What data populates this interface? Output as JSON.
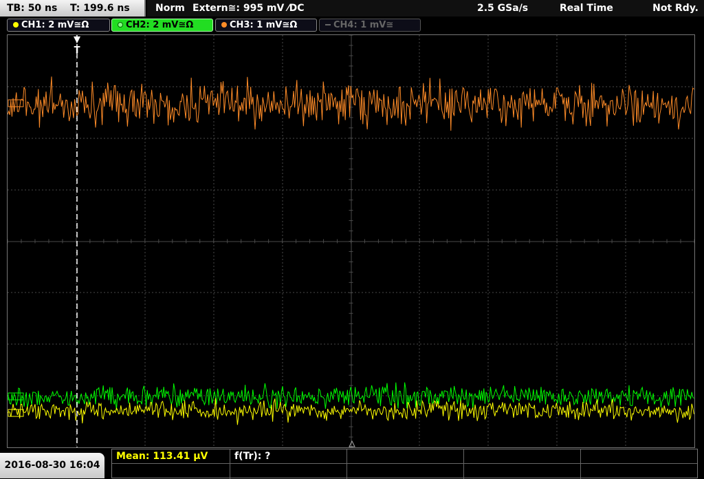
{
  "header": {
    "timebase": "TB: 50 ns",
    "trigger_time": "T: 199.6 ns",
    "trigger_mode": "Norm",
    "trigger_source": "Extern≅: 995 mV ⁄DC",
    "sample_rate": "2.5 GSa/s",
    "acq_mode": "Real Time",
    "status": "Not Rdy."
  },
  "channels": [
    {
      "label": "CH1: 2 mV≅Ω",
      "color": "#ffff00",
      "active": false
    },
    {
      "label": "CH2: 2 mV≅Ω",
      "color": "#00ff00",
      "active": true
    },
    {
      "label": "CH3: 1 mV≅Ω",
      "color": "#ff8c28",
      "active": false
    },
    {
      "label": "CH4: 1 mV≅",
      "color": "#666666",
      "active": false
    }
  ],
  "trigger_marker": "T",
  "footer": {
    "datetime": "2016-08-30 16:04",
    "mean": "Mean: 113.41 µV",
    "ftr": "f(Tr): ?"
  },
  "colors": {
    "ch1": "#ffff00",
    "ch2": "#00ff00",
    "ch3": "#ff8c28",
    "grid": "#4a4a4a"
  }
}
